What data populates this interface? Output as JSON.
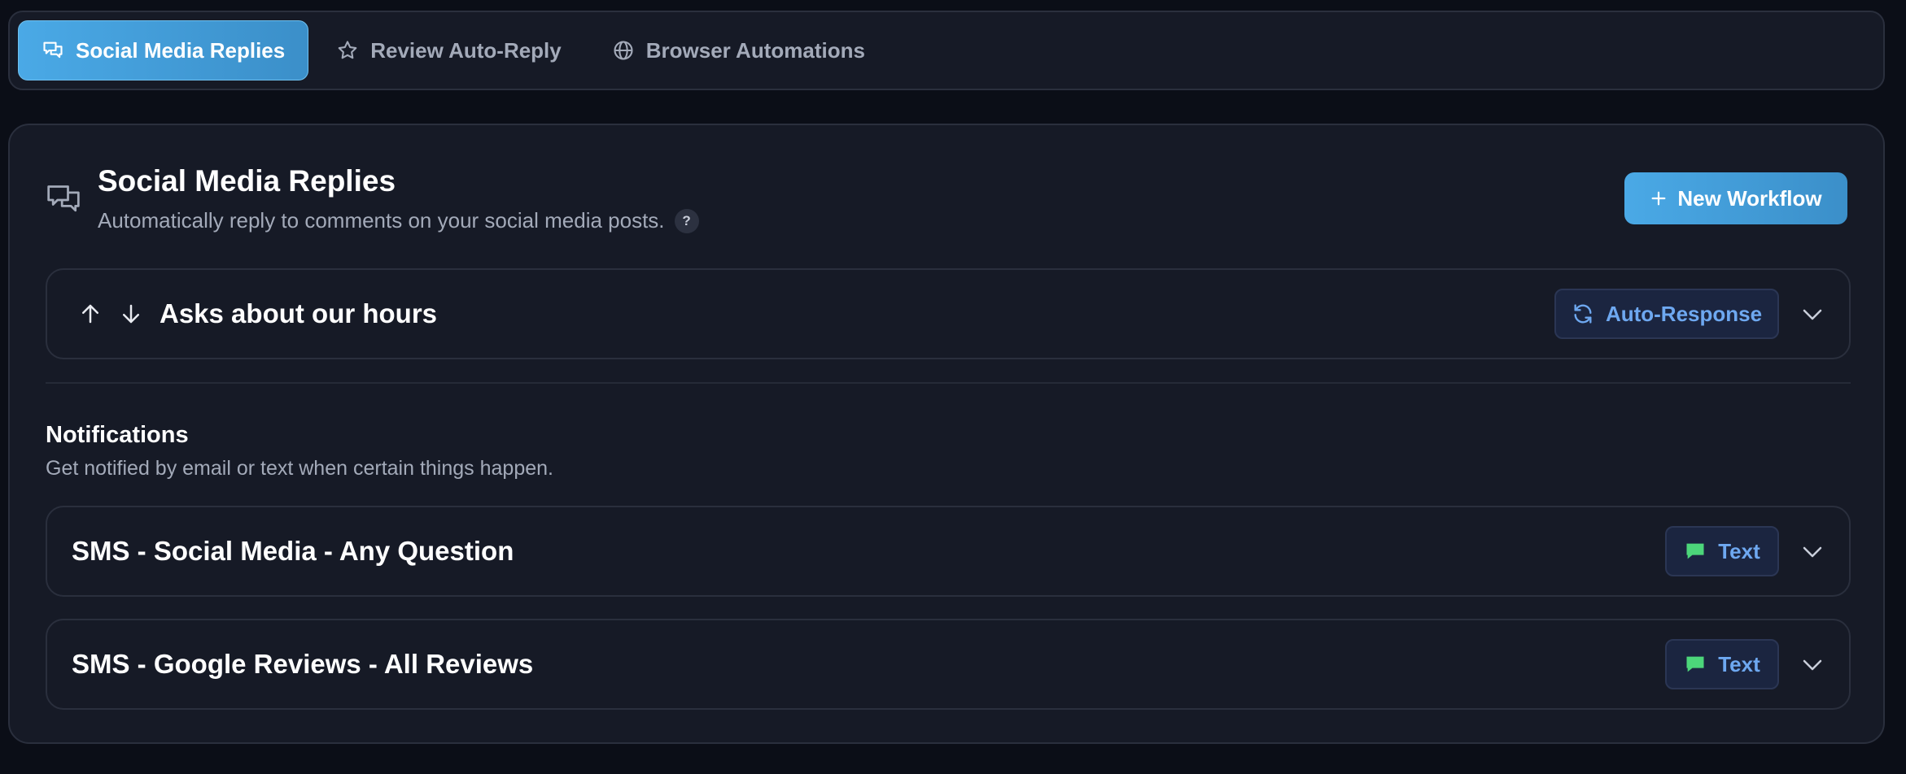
{
  "tabs": [
    {
      "label": "Social Media Replies",
      "icon": "chat-bubbles-icon",
      "active": true
    },
    {
      "label": "Review Auto-Reply",
      "icon": "star-icon",
      "active": false
    },
    {
      "label": "Browser Automations",
      "icon": "globe-icon",
      "active": false
    }
  ],
  "section": {
    "title": "Social Media Replies",
    "subtitle": "Automatically reply to comments on your social media posts.",
    "help": "?",
    "new_button": "New Workflow"
  },
  "workflows": [
    {
      "label": "Asks about our hours",
      "badge": "Auto-Response",
      "badge_icon": "refresh-icon"
    }
  ],
  "notifications": {
    "title": "Notifications",
    "subtitle": "Get notified by email or text when certain things happen.",
    "items": [
      {
        "label": "SMS - Social Media - Any Question",
        "badge": "Text",
        "badge_icon": "message-icon"
      },
      {
        "label": "SMS - Google Reviews - All Reviews",
        "badge": "Text",
        "badge_icon": "message-icon"
      }
    ]
  },
  "colors": {
    "accent": "#4aa9e6",
    "badge_text": "#6ea8f0",
    "message_icon": "#4cd67a"
  }
}
